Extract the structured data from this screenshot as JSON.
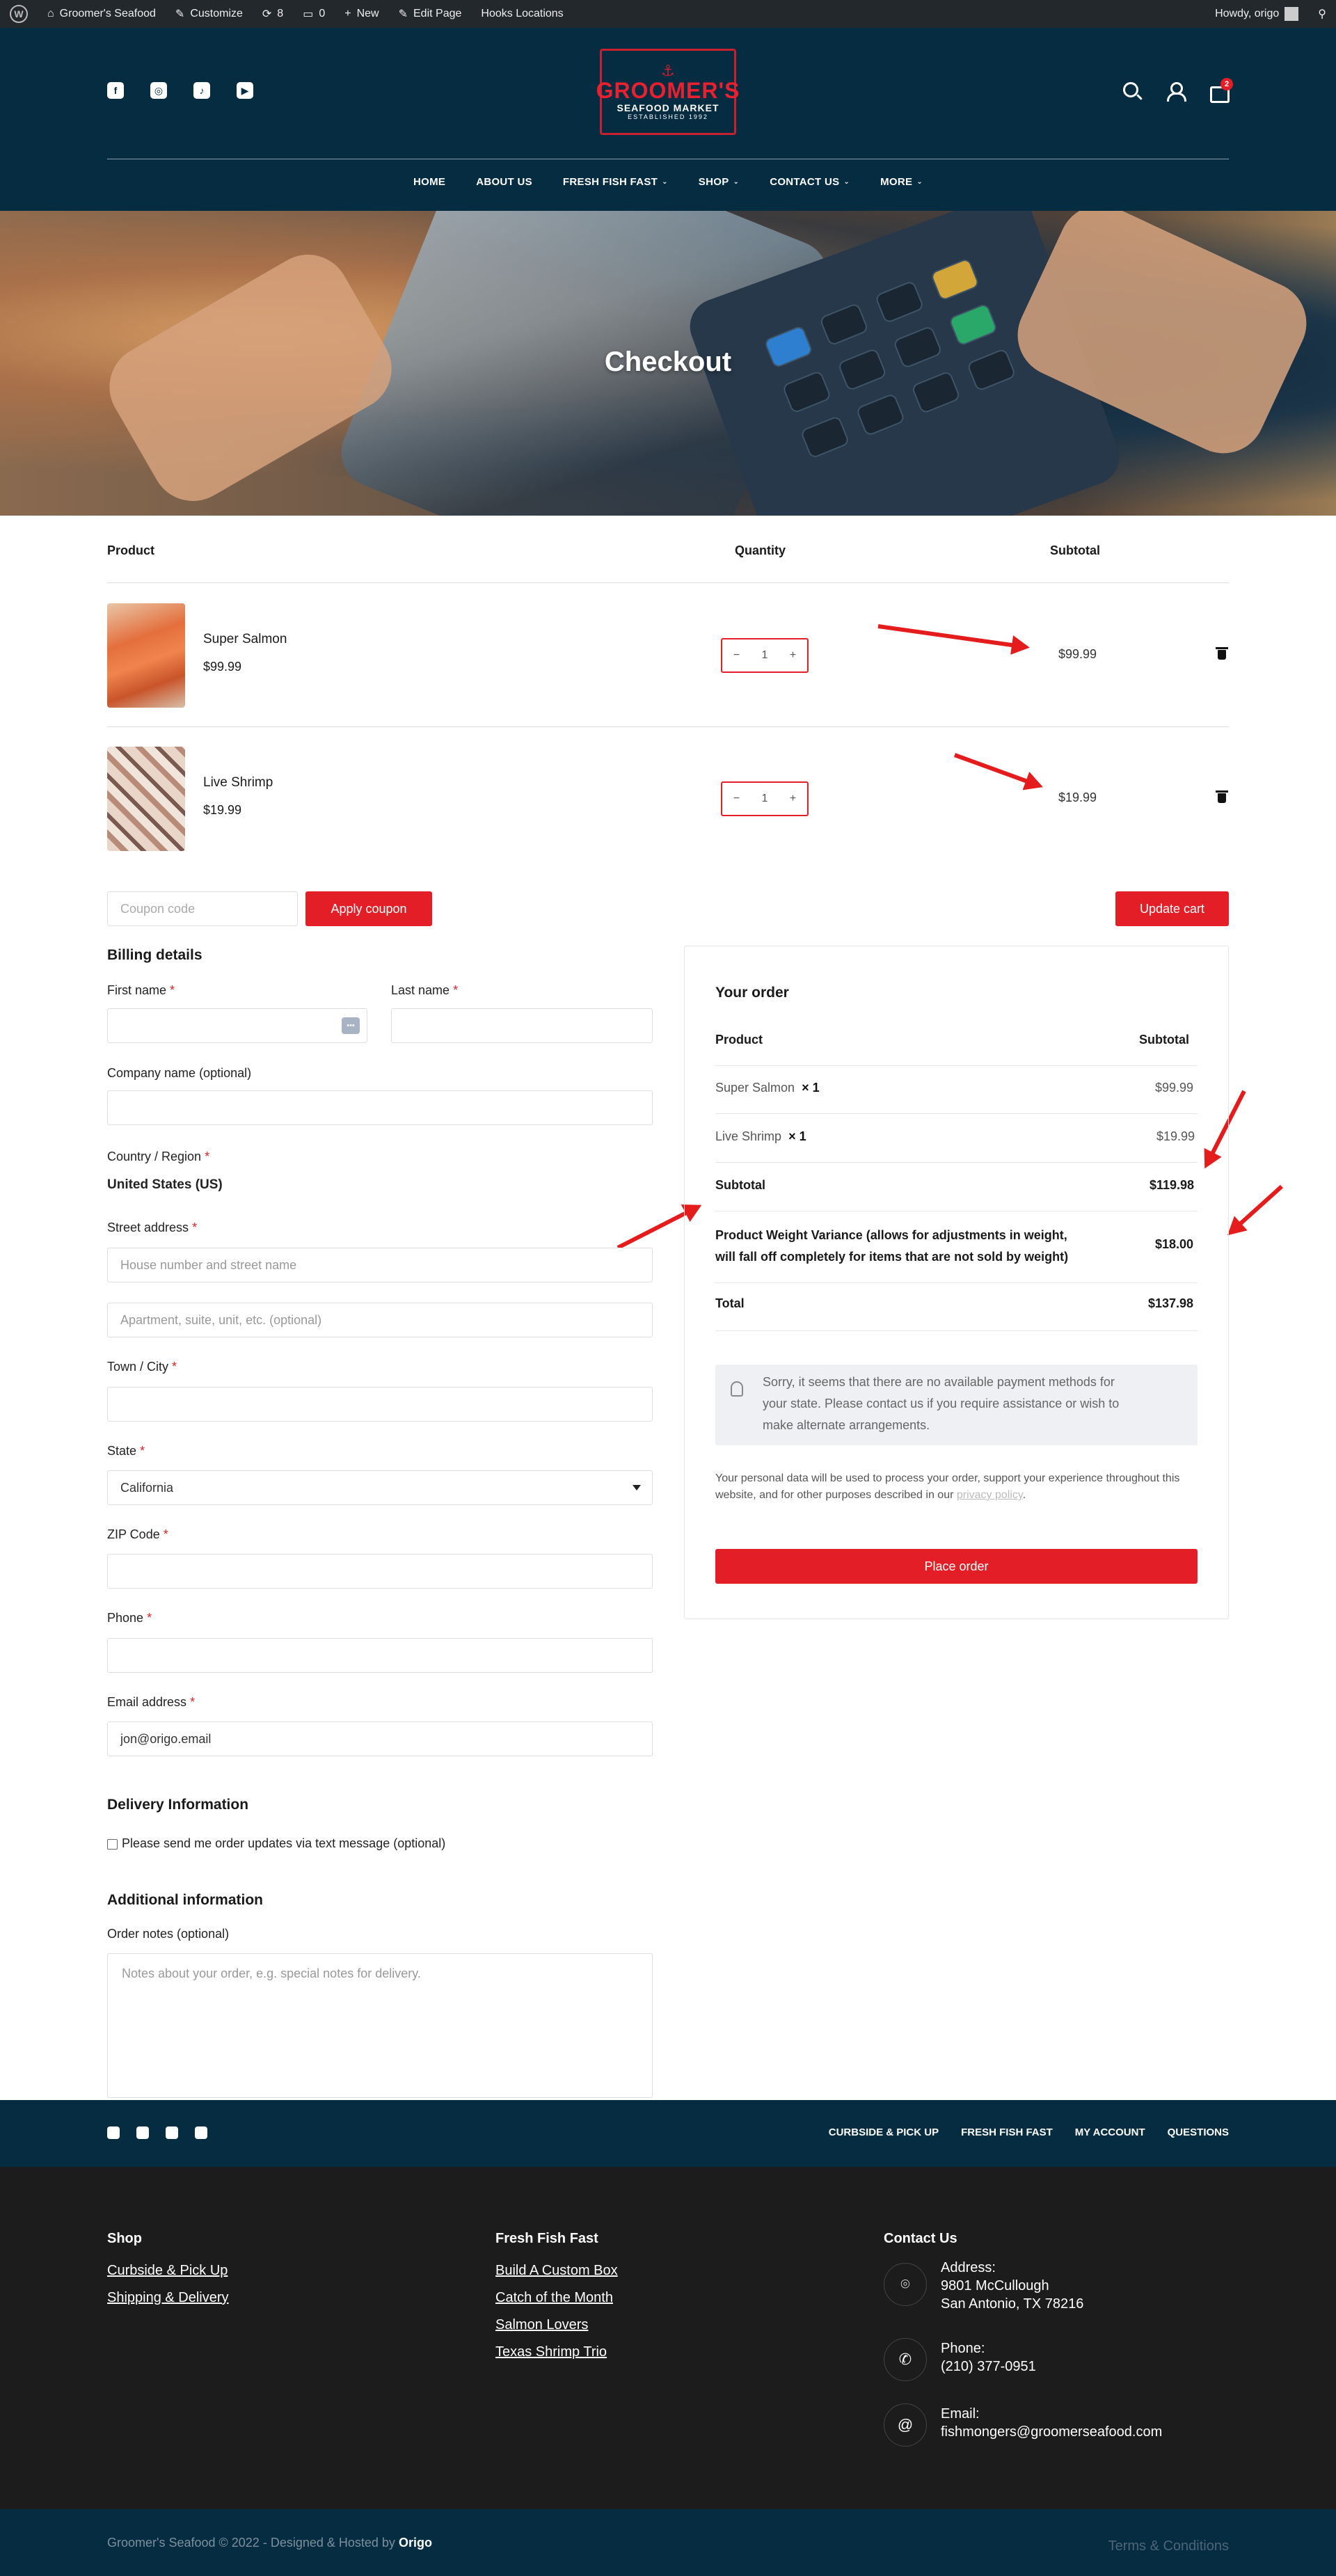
{
  "adminbar": {
    "site": "Groomer's Seafood",
    "customize": "Customize",
    "updates": "8",
    "comments": "0",
    "new": "New",
    "edit_page": "Edit Page",
    "hooks": "Hooks Locations",
    "howdy": "Howdy, origo"
  },
  "logo": {
    "line1": "GROOMER'S",
    "line2": "SEAFOOD MARKET",
    "line3": "ESTABLISHED 1992"
  },
  "cart_count": "2",
  "nav": {
    "items": [
      {
        "label": "HOME"
      },
      {
        "label": "ABOUT US"
      },
      {
        "label": "FRESH FISH FAST"
      },
      {
        "label": "SHOP"
      },
      {
        "label": "CONTACT US"
      },
      {
        "label": "MORE"
      }
    ]
  },
  "hero": {
    "title": "Checkout"
  },
  "cart": {
    "headers": {
      "product": "Product",
      "quantity": "Quantity",
      "subtotal": "Subtotal"
    },
    "items": [
      {
        "name": "Super Salmon",
        "price": "$99.99",
        "qty": "1",
        "subtotal": "$99.99"
      },
      {
        "name": "Live Shrimp",
        "price": "$19.99",
        "qty": "1",
        "subtotal": "$19.99"
      }
    ],
    "qty_minus": "−",
    "qty_plus": "+",
    "coupon_placeholder": "Coupon code",
    "apply_coupon": "Apply coupon",
    "update_cart": "Update cart"
  },
  "billing": {
    "title": "Billing details",
    "first_name": "First name",
    "last_name": "Last name",
    "company": "Company name (optional)",
    "country_label": "Country / Region",
    "country_value": "United States (US)",
    "street_label": "Street address",
    "street_placeholder": "House number and street name",
    "apt_placeholder": "Apartment, suite, unit, etc. (optional)",
    "city_label": "Town / City",
    "state_label": "State",
    "state_value": "California",
    "zip_label": "ZIP Code",
    "phone_label": "Phone",
    "email_label": "Email address",
    "email_value": "jon@origo.email",
    "required_mark": "*"
  },
  "delivery": {
    "title": "Delivery Information",
    "sms_label": "Please send me order updates via text message (optional)"
  },
  "additional": {
    "title": "Additional information",
    "notes_label": "Order notes (optional)",
    "notes_placeholder": "Notes about your order, e.g. special notes for delivery."
  },
  "order": {
    "title": "Your order",
    "col_product": "Product",
    "col_subtotal": "Subtotal",
    "rows": [
      {
        "name": "Super Salmon",
        "qty": "× 1",
        "price": "$99.99"
      },
      {
        "name": "Live Shrimp",
        "qty": "× 1",
        "price": "$19.99"
      }
    ],
    "subtotal_label": "Subtotal",
    "subtotal_value": "$119.98",
    "variance_line1": "Product Weight Variance (allows for adjustments in weight,",
    "variance_line2": "will fall off completely for items that are not sold by weight)",
    "variance_value": "$18.00",
    "total_label": "Total",
    "total_value": "$137.98",
    "notice_line1": "Sorry, it seems that there are no available payment methods for",
    "notice_line2": "your state. Please contact us if you require assistance or wish to",
    "notice_line3": "make alternate arrangements.",
    "privacy_text": "Your personal data will be used to process your order, support your experience throughout this website, and for other purposes described in our",
    "privacy_link": "privacy policy",
    "privacy_end": ".",
    "place_order": "Place order"
  },
  "footer_top": {
    "links": [
      {
        "label": "CURBSIDE & PICK UP"
      },
      {
        "label": "FRESH FISH FAST"
      },
      {
        "label": "MY ACCOUNT"
      },
      {
        "label": "QUESTIONS"
      }
    ]
  },
  "footer": {
    "shop_title": "Shop",
    "shop_links": [
      {
        "label": "Curbside & Pick Up"
      },
      {
        "label": "Shipping & Delivery"
      }
    ],
    "fff_title": "Fresh Fish Fast",
    "fff_links": [
      {
        "label": "Build A Custom Box"
      },
      {
        "label": "Catch of the Month"
      },
      {
        "label": "Salmon Lovers"
      },
      {
        "label": "Texas Shrimp Trio"
      }
    ],
    "contact_title": "Contact Us",
    "address_label": "Address:",
    "address_line1": "9801 McCullough",
    "address_line2": "San Antonio, TX 78216",
    "phone_label": "Phone:",
    "phone_value": "(210) 377-0951",
    "email_label": "Email:",
    "email_value": "fishmongers@groomerseafood.com"
  },
  "bottom": {
    "copyright": "Groomer's Seafood © 2022 - Designed & Hosted by",
    "brand": "Origo",
    "terms": "Terms & Conditions"
  },
  "colors": {
    "navy": "#062c42",
    "red": "#e31e26",
    "footer_dark": "#1c1c1c",
    "annotation_arrow": "#e41c1c"
  }
}
